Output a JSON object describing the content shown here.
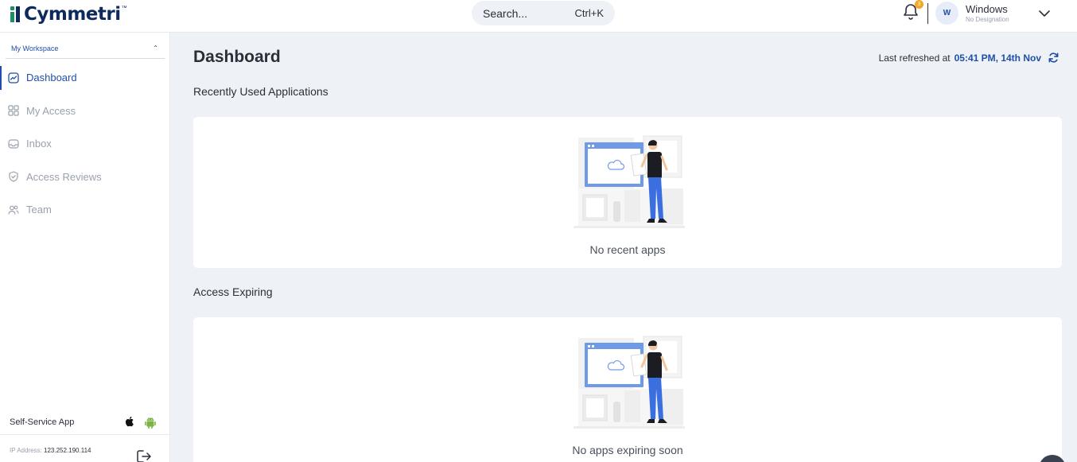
{
  "header": {
    "logo_text": "Cymmetri",
    "logo_tm": "™",
    "search": {
      "label": "Search...",
      "shortcut": "Ctrl+K"
    },
    "notification_count": "3",
    "user": {
      "initial": "W",
      "name": "Windows",
      "designation": "No Designation"
    }
  },
  "sidebar": {
    "workspace_label": "My Workspace",
    "items": [
      {
        "label": "Dashboard",
        "icon": "chart-icon",
        "active": true
      },
      {
        "label": "My Access",
        "icon": "grid-icon",
        "active": false
      },
      {
        "label": "Inbox",
        "icon": "inbox-icon",
        "active": false
      },
      {
        "label": "Access Reviews",
        "icon": "shield-check-icon",
        "active": false
      },
      {
        "label": "Team",
        "icon": "users-icon",
        "active": false
      }
    ],
    "self_service_label": "Self-Service App",
    "ip_label": "IP Address:",
    "ip_value": "123.252.190.114"
  },
  "main": {
    "title": "Dashboard",
    "last_refreshed_label": "Last refreshed at",
    "last_refreshed_value": "05:41 PM, 14th Nov",
    "sections": [
      {
        "title": "Recently Used Applications",
        "empty_text": "No recent apps"
      },
      {
        "title": "Access Expiring",
        "empty_text": "No apps expiring soon"
      }
    ]
  },
  "colors": {
    "primary": "#1f4fa8",
    "brand_navy": "#0e2a5c",
    "brand_green": "#1f8d6b",
    "background": "#eef2f7",
    "badge": "#f5a623",
    "illustration_blue": "#3b6fe0"
  }
}
